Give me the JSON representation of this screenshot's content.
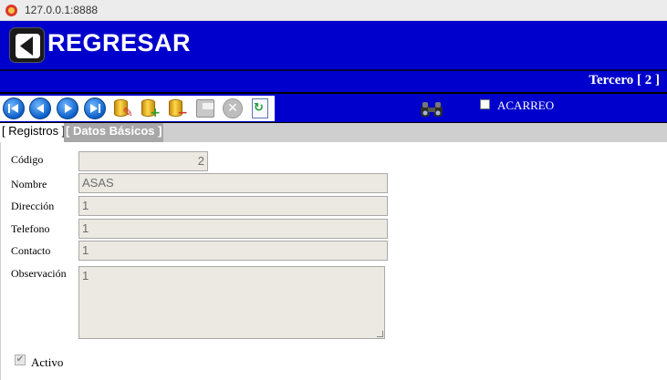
{
  "browser": {
    "url": "127.0.0.1:8888"
  },
  "header": {
    "back_label": "REGRESAR",
    "subtitle": "Tercero [ 2 ]"
  },
  "toolbar": {
    "buttons": [
      "first-record",
      "previous-record",
      "next-record",
      "last-record",
      "database-edit",
      "database-add",
      "database-remove",
      "save",
      "cancel",
      "refresh"
    ],
    "search_icon": "binoculars-icon",
    "acarreo_label": "ACARREO",
    "acarreo_checked": false
  },
  "tabs": {
    "registros": "[ Registros ]",
    "datos_basicos": "[ Datos Básicos ]"
  },
  "form": {
    "codigo_label": "Código",
    "codigo_value": "2",
    "nombre_label": "Nombre",
    "nombre_value": "ASAS",
    "direccion_label": "Dirección",
    "direccion_value": "1",
    "telefono_label": "Telefono",
    "telefono_value": "1",
    "contacto_label": "Contacto",
    "contacto_value": "1",
    "observacion_label": "Observación",
    "observacion_value": "1",
    "activo_label": "Activo",
    "activo_checked": true
  },
  "colors": {
    "header_bg": "#0000cc",
    "field_bg": "#ebe9e2",
    "tab_active_bg": "#a8a8a8"
  }
}
